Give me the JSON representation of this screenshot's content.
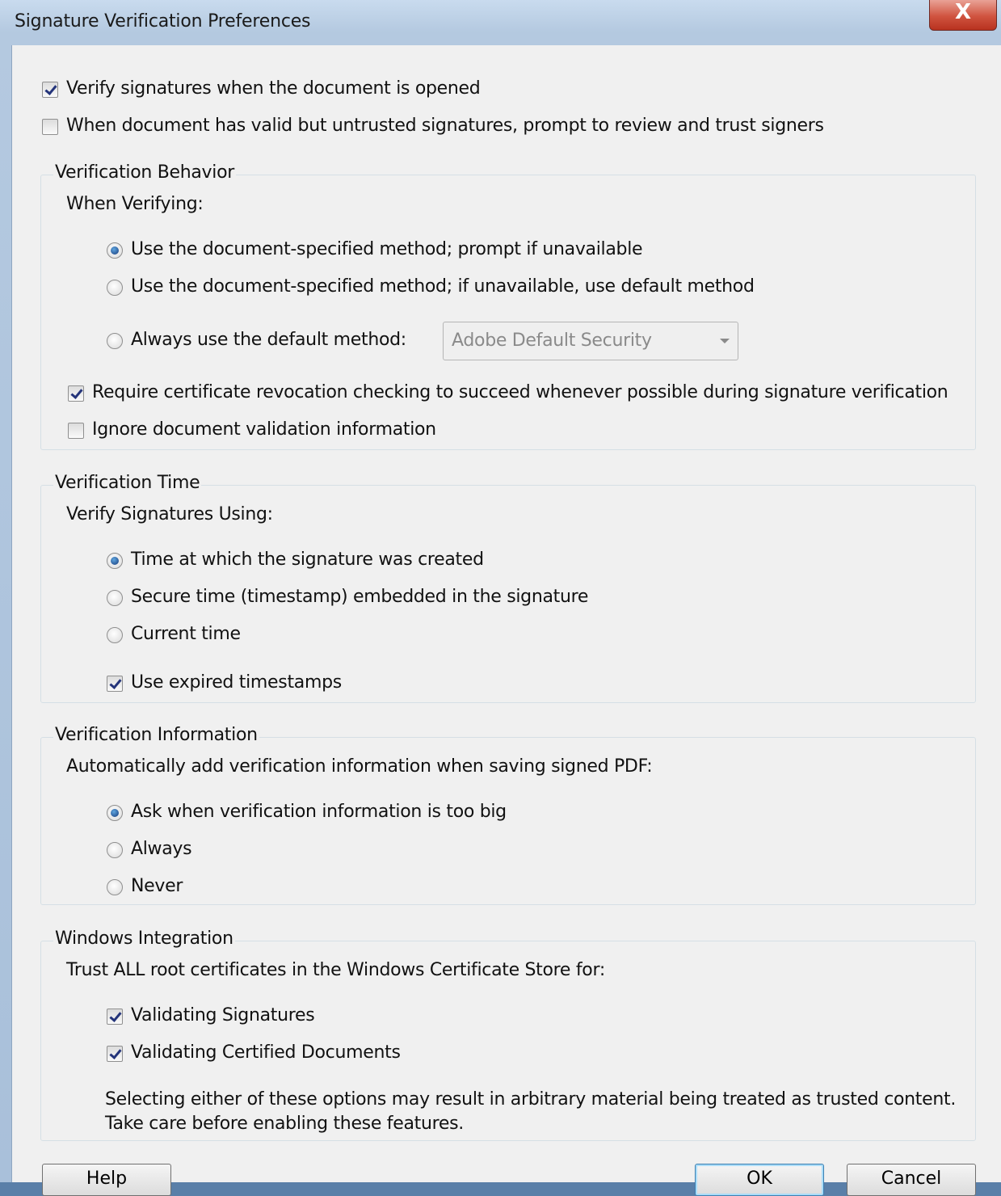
{
  "window": {
    "title": "Signature Verification Preferences",
    "close_label": "X"
  },
  "top_options": {
    "verify_on_open": {
      "label": "Verify signatures when the document is opened",
      "checked": true
    },
    "prompt_untrusted": {
      "label": "When document has valid but untrusted signatures, prompt to review and trust signers",
      "checked": false
    }
  },
  "verification_behavior": {
    "title": "Verification Behavior",
    "subtitle": "When Verifying:",
    "options": [
      {
        "label": "Use the document-specified method; prompt if unavailable",
        "selected": true
      },
      {
        "label": "Use the document-specified method; if unavailable, use default method",
        "selected": false
      },
      {
        "label": "Always use the default method:",
        "selected": false
      }
    ],
    "default_method_value": "Adobe Default Security",
    "require_revocation": {
      "label": "Require certificate revocation checking to succeed whenever possible during signature verification",
      "checked": true
    },
    "ignore_validation": {
      "label": "Ignore document validation information",
      "checked": false
    }
  },
  "verification_time": {
    "title": "Verification Time",
    "subtitle": "Verify Signatures Using:",
    "options": [
      {
        "label": "Time at which the signature was created",
        "selected": true
      },
      {
        "label": "Secure time (timestamp) embedded in the signature",
        "selected": false
      },
      {
        "label": "Current time",
        "selected": false
      }
    ],
    "use_expired": {
      "label": "Use expired timestamps",
      "checked": true
    }
  },
  "verification_info": {
    "title": "Verification Information",
    "subtitle": "Automatically add verification information when saving signed PDF:",
    "options": [
      {
        "label": "Ask when verification information is too big",
        "selected": true
      },
      {
        "label": "Always",
        "selected": false
      },
      {
        "label": "Never",
        "selected": false
      }
    ]
  },
  "windows_integration": {
    "title": "Windows Integration",
    "subtitle": "Trust ALL root certificates in the Windows Certificate Store for:",
    "validating_signatures": {
      "label": "Validating Signatures",
      "checked": true
    },
    "validating_certified": {
      "label": "Validating Certified Documents",
      "checked": true
    },
    "warning_line1": "Selecting either of these options may result in arbitrary material being treated as trusted content.",
    "warning_line2": "Take care before enabling these features."
  },
  "buttons": {
    "help": "Help",
    "ok": "OK",
    "cancel": "Cancel"
  }
}
